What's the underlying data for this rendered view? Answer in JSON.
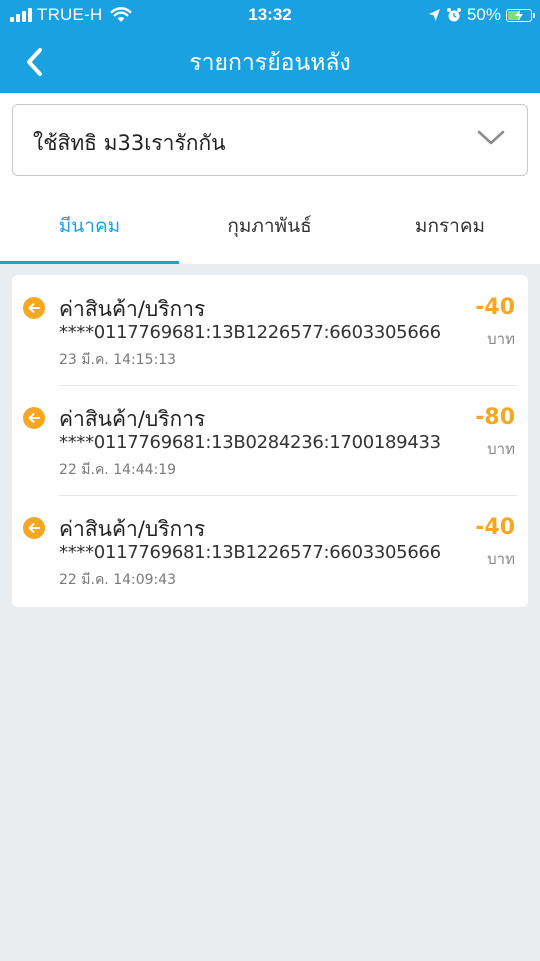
{
  "status_bar": {
    "carrier": "TRUE-H",
    "time": "13:32",
    "battery_percent": "50%",
    "battery_level": 0.5,
    "icons": [
      "signal-icon",
      "wifi-icon",
      "location-icon",
      "alarm-icon",
      "battery-charging-icon"
    ]
  },
  "header": {
    "title": "รายการย้อนหลัง",
    "back_icon": "chevron-left-icon"
  },
  "selector": {
    "value": "ใช้สิทธิ ม33เรารักกัน",
    "icon": "chevron-down-icon"
  },
  "tabs": [
    {
      "label": "มีนาคม",
      "active": true
    },
    {
      "label": "กุมภาพันธ์",
      "active": false
    },
    {
      "label": "มกราคม",
      "active": false
    }
  ],
  "transactions": [
    {
      "title": "ค่าสินค้า/บริการ",
      "reference": "****0117769681:13B1226577:6603305666",
      "datetime": "23 มี.ค. 14:15:13",
      "amount": "-40",
      "unit": "บาท",
      "icon": "arrow-left-circle-icon"
    },
    {
      "title": "ค่าสินค้า/บริการ",
      "reference": "****0117769681:13B0284236:1700189433",
      "datetime": "22 มี.ค. 14:44:19",
      "amount": "-80",
      "unit": "บาท",
      "icon": "arrow-left-circle-icon"
    },
    {
      "title": "ค่าสินค้า/บริการ",
      "reference": "****0117769681:13B1226577:6603305666",
      "datetime": "22 มี.ค. 14:09:43",
      "amount": "-40",
      "unit": "บาท",
      "icon": "arrow-left-circle-icon"
    }
  ],
  "colors": {
    "brand": "#1aa1e2",
    "accent": "#f5a623",
    "background": "#eaedf0"
  }
}
